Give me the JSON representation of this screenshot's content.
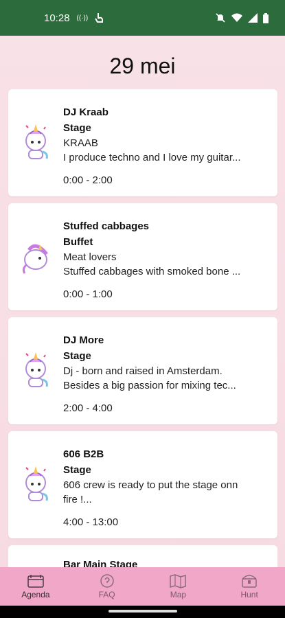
{
  "status": {
    "time": "10:28",
    "cc": "((·))"
  },
  "page": {
    "date": "29 mei"
  },
  "events": [
    {
      "name": "DJ Kraab",
      "location": "Stage",
      "desc1": "KRAAB",
      "desc2": "I produce techno and I love my guitar...",
      "time": "0:00 - 2:00",
      "avatar": "unicorn-icon"
    },
    {
      "name": "Stuffed cabbages",
      "location": "Buffet",
      "desc1": "Meat lovers",
      "desc2": "Stuffed cabbages with smoked bone ...",
      "time": "0:00 - 1:00",
      "avatar": "unicorn-side-icon"
    },
    {
      "name": "DJ More",
      "location": "Stage",
      "desc1": "Dj - born and raised in Amsterdam.",
      "desc2": "Besides a big passion for mixing tec...",
      "time": "2:00 - 4:00",
      "avatar": "unicorn-icon"
    },
    {
      "name": "606 B2B",
      "location": "Stage",
      "desc1": "606 crew is ready to put the stage onn",
      "desc2": "fire !...",
      "time": "4:00 - 13:00",
      "avatar": "unicorn-icon"
    }
  ],
  "partial": {
    "name": "Bar Main Stage"
  },
  "nav": [
    {
      "label": "Agenda",
      "icon": "agenda-icon"
    },
    {
      "label": "FAQ",
      "icon": "faq-icon"
    },
    {
      "label": "Map",
      "icon": "map-icon"
    },
    {
      "label": "Hunt",
      "icon": "hunt-icon"
    }
  ],
  "colors": {
    "statusbar": "#2c6b3b",
    "nav": "#f1a7c8",
    "background": "#f8e1e7"
  }
}
